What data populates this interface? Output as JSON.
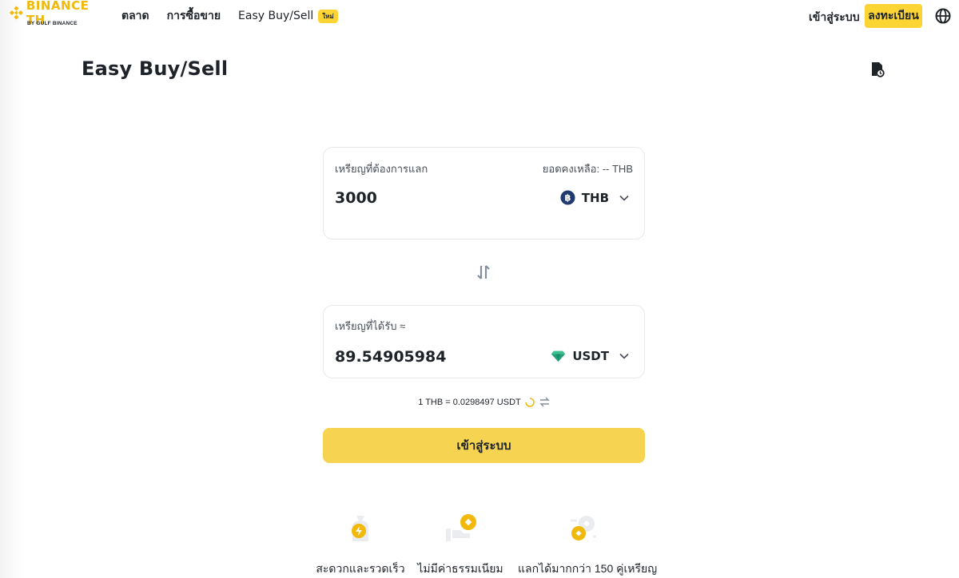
{
  "header": {
    "logo_text": "BINANCE TH",
    "logo_sub": "BY GULF BINANCE",
    "nav": [
      "ตลาด",
      "การซื้อขาย",
      "Easy Buy/Sell"
    ],
    "new_badge": "ใหม่",
    "login": "เข้าสู่ระบบ",
    "register": "ลงทะเบียน",
    "accent_color": "#FCD535"
  },
  "page": {
    "title": "Easy Buy/Sell"
  },
  "from_card": {
    "label": "เหรียญที่ต้องการแลก",
    "balance": "ยอดคงเหลือ: -- THB",
    "amount": "3000",
    "asset": "THB",
    "asset_icon": "baht-coin-icon"
  },
  "to_card": {
    "label": "เหรียญที่ได้รับ ≈",
    "amount": "89.54905984",
    "asset": "USDT",
    "asset_icon": "usdt-gem-icon"
  },
  "rate": "1 THB = 0.0298497 USDT",
  "main_button": "เข้าสู่ระบบ",
  "features": [
    {
      "label": "สะดวกและรวดเร็ว",
      "icon": "money-bag-bolt-icon"
    },
    {
      "label": "ไม่มีค่าธรรมเนียม",
      "icon": "hand-coin-icon"
    },
    {
      "label": "แลกได้มากกว่า 150 คู่เหรียญ",
      "icon": "coin-exchange-icon"
    }
  ]
}
